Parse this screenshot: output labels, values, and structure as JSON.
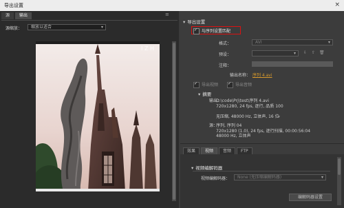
{
  "window": {
    "title": "导出设置",
    "close": "×"
  },
  "left": {
    "tabs": [
      "源",
      "输出"
    ],
    "menu_icon": "≡",
    "source_scaling_label": "源缩放：",
    "source_scaling_value": "缩放以适合",
    "watermark": "I Z H"
  },
  "export": {
    "section": "导出设置",
    "match_sequence": "与序列设置匹配",
    "format_label": "格式：",
    "format_value": "AVI",
    "preset_label": "预设：",
    "preset_value": "",
    "note_label": "注释：",
    "output_label": "输出名称：",
    "output_value": "序列 4.avi",
    "export_video": "导出视频",
    "export_audio": "导出音频"
  },
  "summary": {
    "title": "摘要",
    "output_key": "输出：",
    "output_lines": [
      "D:\\code\\Prj\\test\\序列 4.avi",
      "720x1280, 24 fps, 逐行, 品质 100",
      "无压缩, 48000 Hz, 立体声, 16 位"
    ],
    "source_key": "源：",
    "source_lines": [
      "序列, 序列 04",
      "720x1280 (1.0), 24 fps, 逐行扫描, 00:00:56:04",
      "48000 Hz, 立体声"
    ]
  },
  "bottom_tabs": [
    "效果",
    "视频",
    "音频",
    "FTP"
  ],
  "video_codec": {
    "section": "视频编解码器",
    "label": "视频编解码器：",
    "value": "None (无压缩编解码器)",
    "button": "编解码器设置"
  },
  "colors": {
    "accent": "#d99a2b",
    "highlight_red": "#dd1111"
  }
}
